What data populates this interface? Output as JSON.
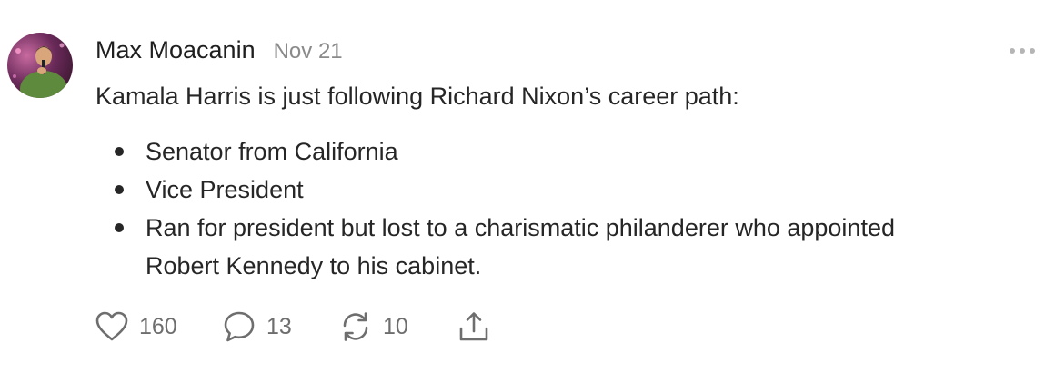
{
  "post": {
    "author": "Max Moacanin",
    "date": "Nov 21",
    "text": "Kamala Harris is just following Richard Nixon’s career path:",
    "bullets": [
      "Senator from California",
      "Vice President",
      "Ran for president but lost to a charismatic philanderer who appointed",
      "Robert Kennedy to his cabinet."
    ],
    "actions": {
      "likes": "160",
      "comments": "13",
      "restacks": "10"
    }
  },
  "icons": {
    "more": "more-horizontal-icon",
    "like": "heart-icon",
    "comment": "comment-bubble-icon",
    "restack": "restack-arrows-icon",
    "share": "share-upload-icon"
  },
  "colors": {
    "text": "#262626",
    "muted": "#8a8a8a",
    "icon": "#6e6e6e"
  }
}
